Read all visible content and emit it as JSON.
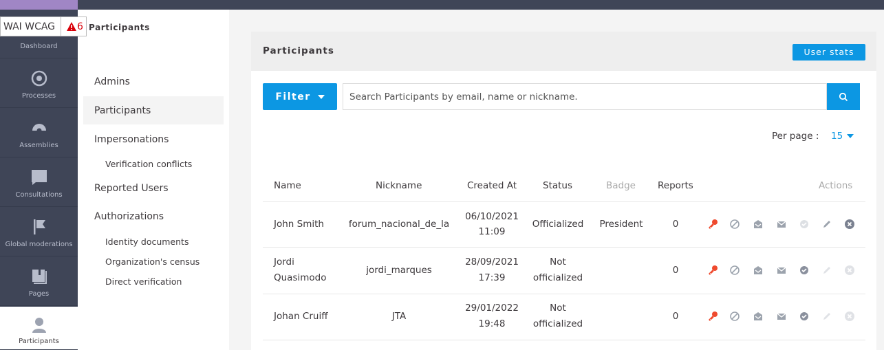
{
  "wai": {
    "name": "WAI WCAG",
    "count": "6"
  },
  "iconbar": {
    "items": [
      {
        "label": "Dashboard",
        "icon": "dashboard-icon"
      },
      {
        "label": "Processes",
        "icon": "processes-icon"
      },
      {
        "label": "Assemblies",
        "icon": "assemblies-icon"
      },
      {
        "label": "Consultations",
        "icon": "consultations-icon"
      },
      {
        "label": "Global moderations",
        "icon": "flag-icon"
      },
      {
        "label": "Pages",
        "icon": "book-icon"
      },
      {
        "label": "Participants",
        "icon": "user-icon"
      }
    ]
  },
  "secondary": {
    "title": "Participants",
    "items": [
      "Admins",
      "Participants",
      "Impersonations",
      "Verification conflicts",
      "Reported Users",
      "Authorizations",
      "Identity documents",
      "Organization's census",
      "Direct verification"
    ]
  },
  "card": {
    "title": "Participants",
    "stats_button": "User stats",
    "filter_button": "Filter",
    "search_placeholder": "Search Participants by email, name or nickname.",
    "per_page_label": "Per page :",
    "per_page_value": "15"
  },
  "table": {
    "headers": [
      "Name",
      "Nickname",
      "Created At",
      "Status",
      "Badge",
      "Reports",
      "Actions"
    ],
    "rows": [
      {
        "name1": "John Smith",
        "name2": "",
        "nickname": "forum_nacional_de_la",
        "date": "06/10/2021",
        "time": "11:09",
        "status1": "Officialized",
        "status2": "",
        "badge": "President",
        "reports": "0"
      },
      {
        "name1": "Jordi",
        "name2": "Quasimodo",
        "nickname": "jordi_marques",
        "date": "28/09/2021",
        "time": "17:39",
        "status1": "Not",
        "status2": "officialized",
        "badge": "",
        "reports": "0"
      },
      {
        "name1": "Johan Cruiff",
        "name2": "",
        "nickname": "JTA",
        "date": "29/01/2022",
        "time": "19:48",
        "status1": "Not",
        "status2": "officialized",
        "badge": "",
        "reports": "0"
      }
    ]
  },
  "colors": {
    "primary": "#0c97e3",
    "danger": "#ef4a2e",
    "sidebar": "#3f4557"
  }
}
